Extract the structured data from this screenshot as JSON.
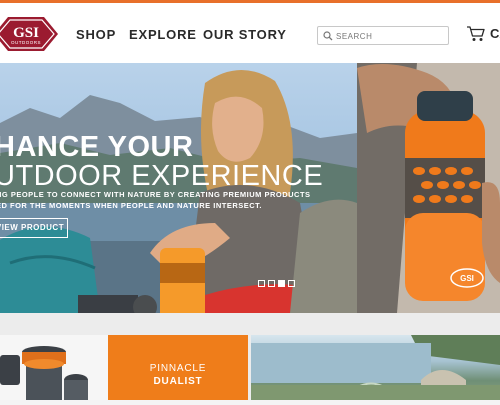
{
  "brand": {
    "name": "GSI",
    "sub": "OUTDOORS",
    "color": "#9b1b30",
    "accent": "#e8702a"
  },
  "nav": {
    "items": [
      "SHOP",
      "EXPLORE",
      "OUR STORY"
    ]
  },
  "search": {
    "placeholder": "SEARCH",
    "icon": "search-icon"
  },
  "cart": {
    "label": "CA",
    "icon": "cart-icon"
  },
  "hero": {
    "title_line1": "HANCE YOUR",
    "title_line2": "UTDOOR EXPERIENCE",
    "subtitle_line1": "NG PEOPLE TO CONNECT WITH NATURE BY CREATING PREMIUM PRODUCTS",
    "subtitle_line2": "ED FOR THE MOMENTS WHEN PEOPLE AND NATURE INTERSECT.",
    "button": "VIEW PRODUCT",
    "bottle_logo": "GSI",
    "slides": 4,
    "active_slide": 3
  },
  "promo": {
    "line1": "PINNACLE",
    "line2": "DUALIST",
    "color": "#ef7d1a"
  }
}
